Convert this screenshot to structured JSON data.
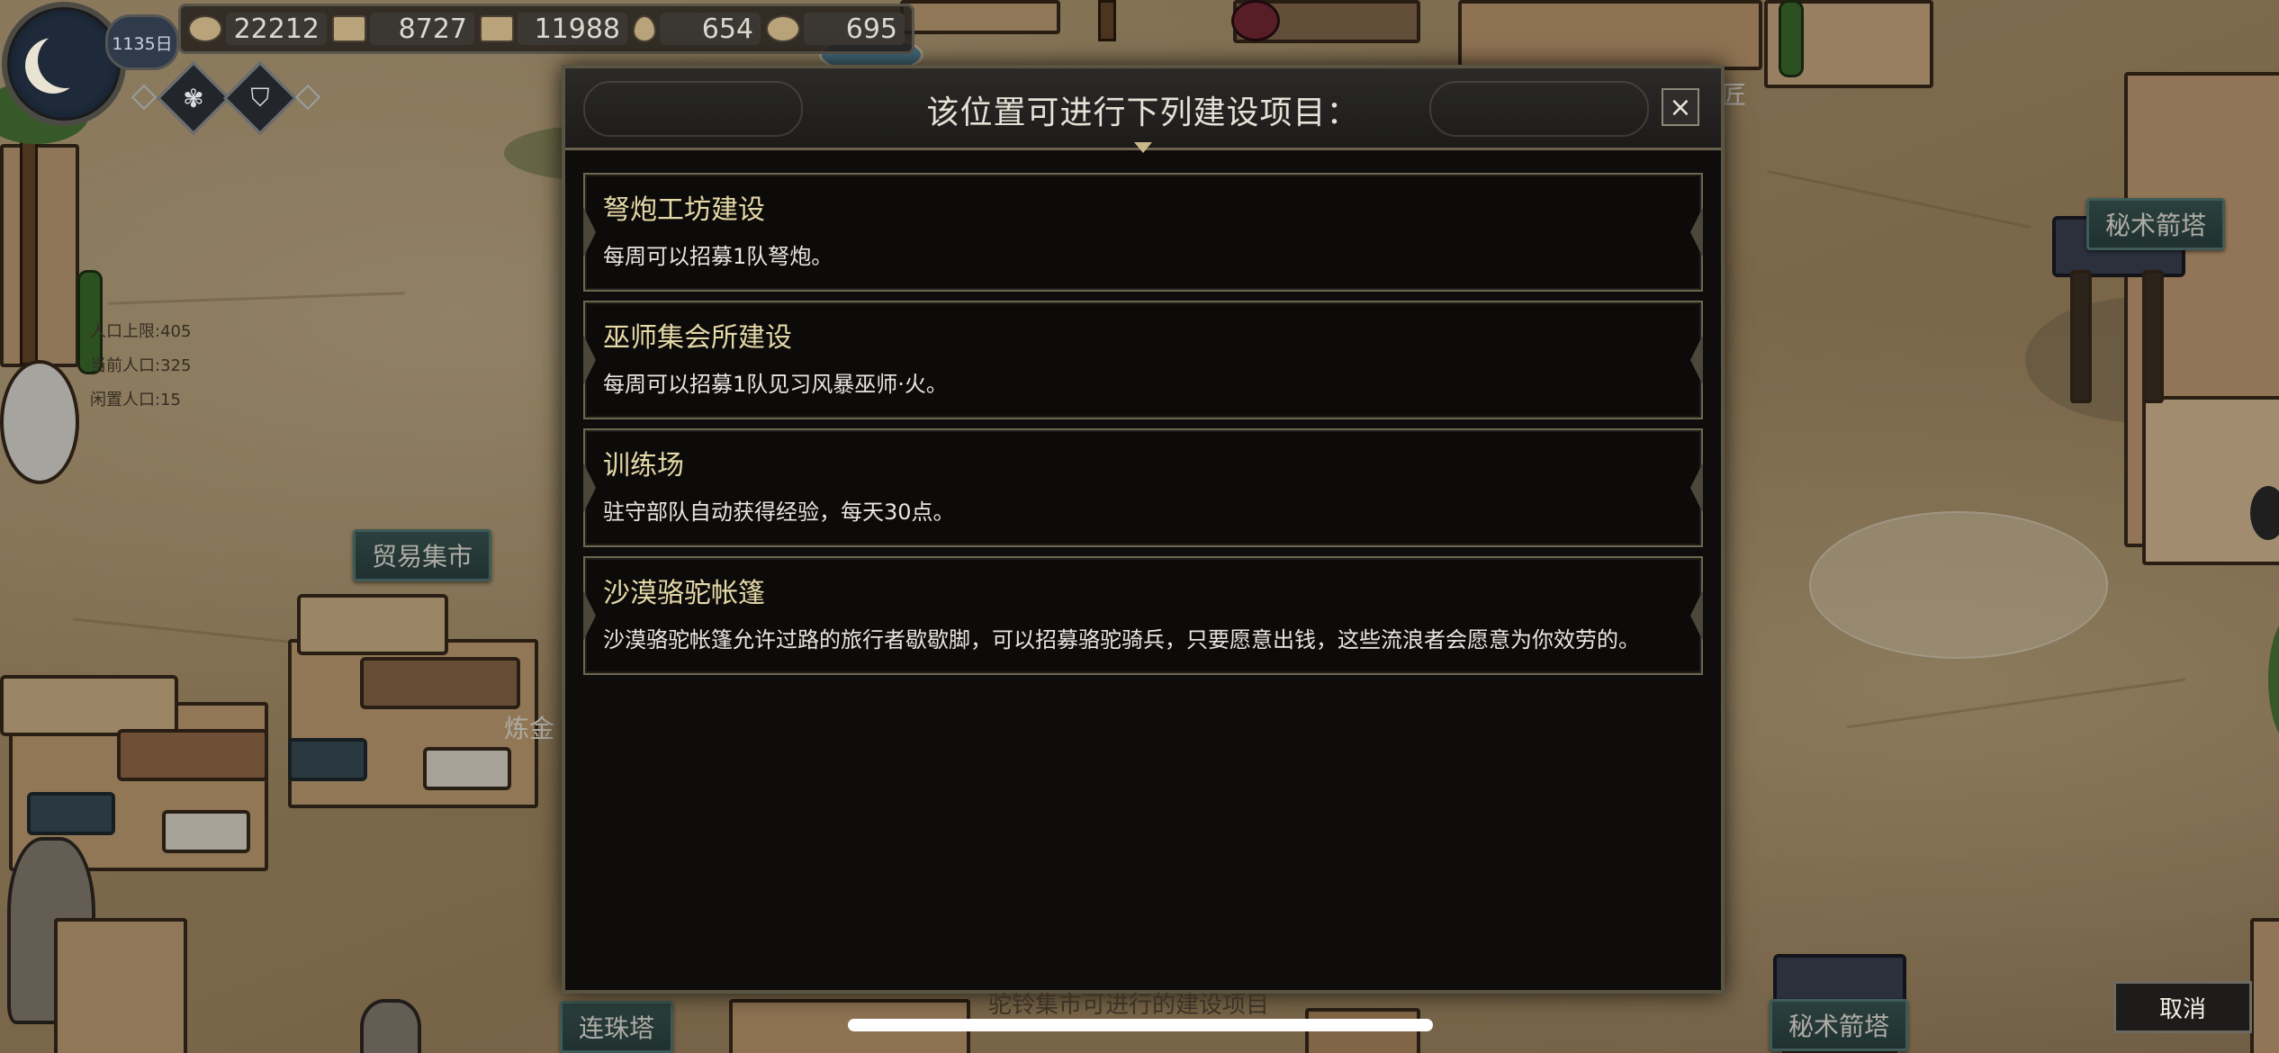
{
  "hud": {
    "day": "1135日",
    "resources": [
      {
        "icon": "gold-coin-icon",
        "value": "22212"
      },
      {
        "icon": "ore-icon",
        "value": "8727"
      },
      {
        "icon": "grain-icon",
        "value": "11988"
      },
      {
        "icon": "water-drop-icon",
        "value": "654"
      },
      {
        "icon": "horn-icon",
        "value": "695"
      }
    ],
    "badges": [
      "fleur-emblem-icon",
      "shield-emblem-icon"
    ]
  },
  "map": {
    "labels": {
      "trade_market": "贸易集市",
      "arcane_tower_top": "秘术箭塔",
      "arcane_tower_bottom": "秘术箭塔",
      "chain_tower": "连珠塔",
      "alchemy_partial": "炼金",
      "smith_partial": "匠"
    },
    "stats": {
      "pop_cap": "人口上限:405",
      "pop_current": "当前人口:325",
      "pop_idle": "闲置人口:15"
    }
  },
  "dialog": {
    "title": "该位置可进行下列建设项目：",
    "close_label": "×",
    "options": [
      {
        "title": "弩炮工坊建设",
        "desc": "每周可以招募1队弩炮。"
      },
      {
        "title": "巫师集会所建设",
        "desc": "每周可以招募1队见习风暴巫师·火。"
      },
      {
        "title": "训练场",
        "desc": "驻守部队自动获得经验，每天30点。"
      },
      {
        "title": "沙漠骆驼帐篷",
        "desc": "沙漠骆驼帐篷允许过路的旅行者歇歇脚，可以招募骆驼骑兵，只要愿意出钱，这些流浪者会愿意为你效劳的。"
      }
    ]
  },
  "bottom": {
    "caption": "驼铃集市可进行的建设项目",
    "cancel_label": "取消"
  }
}
